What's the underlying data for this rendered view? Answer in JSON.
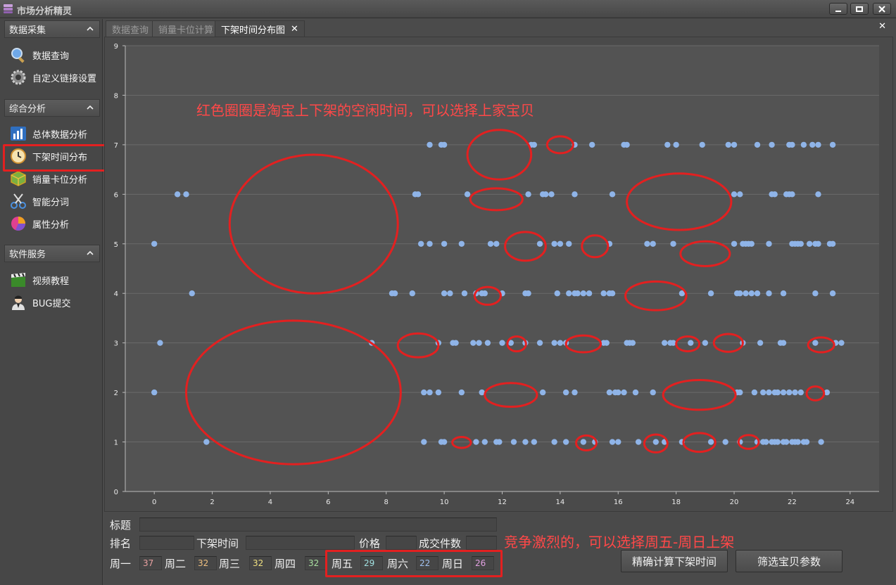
{
  "app": {
    "title": "市场分析精灵"
  },
  "sidebar": {
    "sections": [
      {
        "label": "数据采集",
        "items": [
          {
            "label": "数据查询",
            "icon": "magnifier-icon"
          },
          {
            "label": "自定义链接设置",
            "icon": "gear-icon"
          }
        ]
      },
      {
        "label": "综合分析",
        "items": [
          {
            "label": "总体数据分析",
            "icon": "bar-chart-icon"
          },
          {
            "label": "下架时间分布",
            "icon": "clock-icon"
          },
          {
            "label": "销量卡位分析",
            "icon": "cube-icon"
          },
          {
            "label": "智能分词",
            "icon": "scissors-icon"
          },
          {
            "label": "属性分析",
            "icon": "pie-chart-icon"
          }
        ]
      },
      {
        "label": "软件服务",
        "items": [
          {
            "label": "视频教程",
            "icon": "clapperboard-icon"
          },
          {
            "label": "BUG提交",
            "icon": "user-icon"
          }
        ]
      }
    ]
  },
  "tabs": [
    {
      "label": "数据查询",
      "active": false
    },
    {
      "label": "销量卡位计算",
      "active": false
    },
    {
      "label": "下架时间分布图",
      "active": true
    }
  ],
  "chart_data": {
    "type": "scatter",
    "title": "",
    "xlabel": "",
    "ylabel": "",
    "xlim": [
      -1,
      25
    ],
    "ylim": [
      0,
      9
    ],
    "xticks": [
      0,
      2,
      4,
      6,
      8,
      10,
      12,
      14,
      16,
      18,
      20,
      22,
      24
    ],
    "yticks": [
      0,
      1,
      2,
      3,
      4,
      5,
      6,
      7,
      8,
      9
    ],
    "grid": true,
    "marker_color": "#8fb4e8",
    "series": [
      {
        "y": 7,
        "x": [
          9.5,
          9.9,
          10.0,
          13.0,
          13.1,
          14.5,
          15.1,
          16.2,
          16.3,
          17.7,
          18.0,
          18.9,
          19.8,
          20.0,
          20.8,
          21.3,
          21.9,
          22.0,
          22.4,
          22.7,
          22.9,
          23.4
        ]
      },
      {
        "y": 6,
        "x": [
          0.8,
          1.1,
          9.0,
          9.1,
          10.8,
          12.9,
          13.4,
          13.5,
          13.7,
          14.5,
          15.8,
          20.0,
          20.2,
          21.3,
          21.4,
          21.8,
          21.9,
          22.0,
          22.9
        ]
      },
      {
        "y": 5,
        "x": [
          0.0,
          9.2,
          9.5,
          10.0,
          10.6,
          11.6,
          11.8,
          13.3,
          13.8,
          14.0,
          14.3,
          15.7,
          17.0,
          17.2,
          17.9,
          20.0,
          20.3,
          20.4,
          20.5,
          20.6,
          21.2,
          22.0,
          22.1,
          22.2,
          22.3,
          22.6,
          22.8,
          22.9,
          23.3,
          23.4
        ]
      },
      {
        "y": 4,
        "x": [
          1.3,
          8.2,
          8.3,
          8.9,
          10.0,
          10.2,
          10.7,
          11.1,
          11.3,
          11.4,
          12.0,
          12.8,
          12.9,
          13.9,
          14.3,
          14.5,
          14.6,
          14.8,
          15.0,
          15.5,
          15.7,
          15.8,
          18.2,
          19.2,
          20.1,
          20.2,
          20.4,
          20.6,
          20.8,
          21.2,
          21.7,
          22.8,
          23.4
        ]
      },
      {
        "y": 3,
        "x": [
          0.2,
          7.5,
          9.8,
          10.3,
          10.4,
          11.0,
          11.2,
          11.5,
          12.0,
          12.3,
          12.8,
          13.3,
          13.8,
          14.0,
          14.2,
          15.5,
          15.6,
          16.3,
          16.4,
          16.5,
          17.6,
          17.8,
          17.9,
          18.5,
          19.0,
          20.3,
          20.9,
          21.6,
          21.7,
          22.8,
          23.5,
          23.7
        ]
      },
      {
        "y": 2,
        "x": [
          0.0,
          9.3,
          9.5,
          9.8,
          10.6,
          11.3,
          13.4,
          14.2,
          14.5,
          15.7,
          15.9,
          16.0,
          16.2,
          16.6,
          17.2,
          20.1,
          20.2,
          20.7,
          21.0,
          21.2,
          21.4,
          21.5,
          21.7,
          21.9,
          22.1,
          22.3,
          23.2
        ]
      },
      {
        "y": 1,
        "x": [
          1.8,
          9.3,
          9.9,
          10.0,
          11.1,
          11.4,
          11.8,
          11.9,
          12.4,
          12.8,
          13.1,
          13.8,
          14.2,
          14.8,
          15.2,
          15.8,
          16.0,
          16.7,
          17.3,
          17.6,
          18.2,
          19.2,
          19.7,
          20.2,
          20.8,
          21.0,
          21.1,
          21.3,
          21.4,
          21.5,
          21.7,
          21.8,
          22.0,
          22.1,
          22.2,
          22.4,
          22.5,
          23.0
        ]
      }
    ]
  },
  "annotations": {
    "top_note": "红色圈圈是淘宝上下架的空闲时间，可以选择上家宝贝",
    "bottom_note": "竞争激烈的，可以选择周五-周日上架",
    "ellipses": [
      {
        "cx": 5.5,
        "cy": 5.4,
        "rx": 2.9,
        "ry": 1.4
      },
      {
        "cx": 4.8,
        "cy": 2.0,
        "rx": 3.7,
        "ry": 1.45
      },
      {
        "cx": 11.9,
        "cy": 6.8,
        "rx": 1.1,
        "ry": 0.5
      },
      {
        "cx": 14.0,
        "cy": 7.0,
        "rx": 0.45,
        "ry": 0.17
      },
      {
        "cx": 11.8,
        "cy": 5.9,
        "rx": 0.9,
        "ry": 0.22
      },
      {
        "cx": 18.1,
        "cy": 5.85,
        "rx": 1.8,
        "ry": 0.57
      },
      {
        "cx": 12.8,
        "cy": 4.95,
        "rx": 0.7,
        "ry": 0.29
      },
      {
        "cx": 15.2,
        "cy": 4.95,
        "rx": 0.45,
        "ry": 0.22
      },
      {
        "cx": 19.0,
        "cy": 4.8,
        "rx": 0.85,
        "ry": 0.25
      },
      {
        "cx": 11.5,
        "cy": 3.95,
        "rx": 0.45,
        "ry": 0.18
      },
      {
        "cx": 17.3,
        "cy": 3.95,
        "rx": 1.05,
        "ry": 0.29
      },
      {
        "cx": 9.1,
        "cy": 2.95,
        "rx": 0.7,
        "ry": 0.24
      },
      {
        "cx": 12.5,
        "cy": 2.98,
        "rx": 0.32,
        "ry": 0.15
      },
      {
        "cx": 14.8,
        "cy": 2.98,
        "rx": 0.6,
        "ry": 0.17
      },
      {
        "cx": 18.4,
        "cy": 2.98,
        "rx": 0.4,
        "ry": 0.15
      },
      {
        "cx": 19.8,
        "cy": 3.0,
        "rx": 0.5,
        "ry": 0.18
      },
      {
        "cx": 23.0,
        "cy": 2.96,
        "rx": 0.45,
        "ry": 0.15
      },
      {
        "cx": 12.3,
        "cy": 1.95,
        "rx": 0.9,
        "ry": 0.24
      },
      {
        "cx": 18.8,
        "cy": 1.95,
        "rx": 1.25,
        "ry": 0.3
      },
      {
        "cx": 22.8,
        "cy": 1.98,
        "rx": 0.3,
        "ry": 0.14
      },
      {
        "cx": 10.6,
        "cy": 0.99,
        "rx": 0.32,
        "ry": 0.11
      },
      {
        "cx": 14.9,
        "cy": 0.98,
        "rx": 0.35,
        "ry": 0.15
      },
      {
        "cx": 17.3,
        "cy": 0.97,
        "rx": 0.4,
        "ry": 0.18
      },
      {
        "cx": 18.8,
        "cy": 0.99,
        "rx": 0.55,
        "ry": 0.19
      },
      {
        "cx": 20.5,
        "cy": 1.0,
        "rx": 0.35,
        "ry": 0.14
      }
    ]
  },
  "form": {
    "title_label": "标题",
    "title_value": "",
    "rank_label": "排名",
    "rank_value": "",
    "delist_label": "下架时间",
    "delist_value": "",
    "price_label": "价格",
    "price_value": "",
    "sold_label": "成交件数",
    "sold_value": "",
    "days": [
      {
        "label": "周一",
        "value": "37",
        "color": "#e8a0a0"
      },
      {
        "label": "周二",
        "value": "32",
        "color": "#f0c080"
      },
      {
        "label": "周三",
        "value": "32",
        "color": "#f0e080"
      },
      {
        "label": "周四",
        "value": "32",
        "color": "#a8e0a0"
      },
      {
        "label": "周五",
        "value": "29",
        "color": "#a0e0e0"
      },
      {
        "label": "周六",
        "value": "22",
        "color": "#a0c0f0"
      },
      {
        "label": "周日",
        "value": "26",
        "color": "#e0a0e0"
      }
    ],
    "calc_button": "精确计算下架时间",
    "filter_button": "筛选宝贝参数"
  }
}
